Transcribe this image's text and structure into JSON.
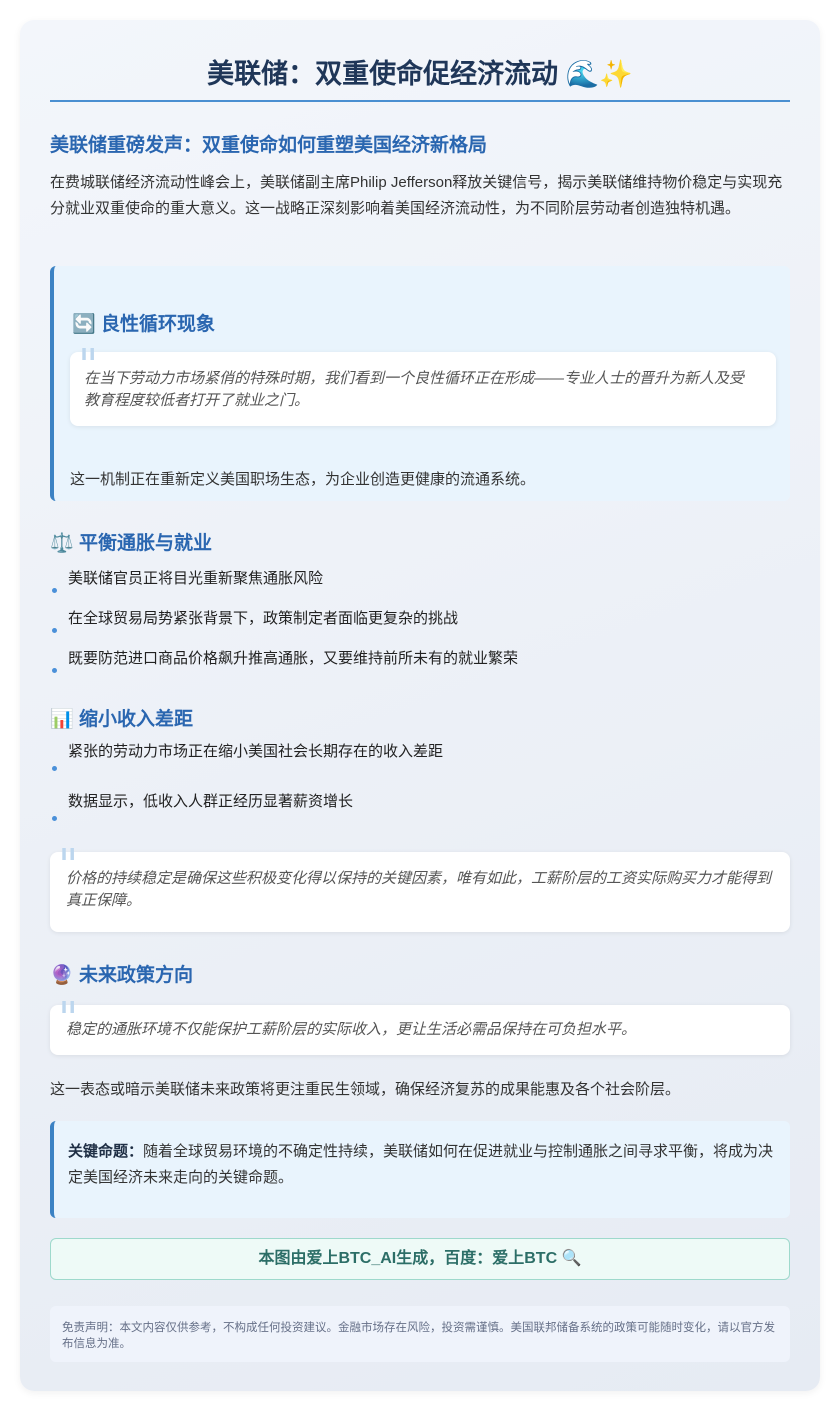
{
  "title": "美联储：双重使命促经济流动",
  "title_emojis": "🌊✨",
  "subtitle": "美联储重磅发声：双重使命如何重塑美国经济新格局",
  "intro": "在费城联储经济流动性峰会上，美联储副主席Philip Jefferson释放关键信号，揭示美联储维持物价稳定与实现充分就业双重使命的重大意义。这一战略正深刻影响着美国经济流动性，为不同阶层劳动者创造独特机遇。",
  "cycle": {
    "icon": "🔄",
    "heading": "良性循环现象",
    "quote": "在当下劳动力市场紧俏的特殊时期，我们看到一个良性循环正在形成——专业人士的晋升为新人及受教育程度较低者打开了就业之门。",
    "note": "这一机制正在重新定义美国职场生态，为企业创造更健康的流通系统。"
  },
  "balance": {
    "icon": "⚖️",
    "heading": "平衡通胀与就业",
    "items": [
      "美联储官员正将目光重新聚焦通胀风险",
      "在全球贸易局势紧张背景下，政策制定者面临更复杂的挑战",
      "既要防范进口商品价格飙升推高通胀，又要维持前所未有的就业繁荣"
    ]
  },
  "income": {
    "icon": "📊",
    "heading": "缩小收入差距",
    "items": [
      "紧张的劳动力市场正在缩小美国社会长期存在的收入差距",
      "数据显示，低收入人群正经历显著薪资增长"
    ],
    "quote": "价格的持续稳定是确保这些积极变化得以保持的关键因素，唯有如此，工薪阶层的工资实际购买力才能得到真正保障。"
  },
  "future": {
    "icon": "🔮",
    "heading": "未来政策方向",
    "quote": "稳定的通胀环境不仅能保护工薪阶层的实际收入，更让生活必需品保持在可负担水平。",
    "note": "这一表态或暗示美联储未来政策将更注重民生领域，确保经济复苏的成果能惠及各个社会阶层。"
  },
  "key": {
    "label": "关键命题：",
    "text": "随着全球贸易环境的不确定性持续，美联储如何在促进就业与控制通胀之间寻求平衡，将成为决定美国经济未来走向的关键命题。"
  },
  "generated": "本图由爱上BTC_AI生成，百度：爱上BTC 🔍",
  "disclaimer": "免责声明：本文内容仅供参考，不构成任何投资建议。金融市场存在风险，投资需谨慎。美国联邦储备系统的政策可能随时变化，请以官方发布信息为准。"
}
